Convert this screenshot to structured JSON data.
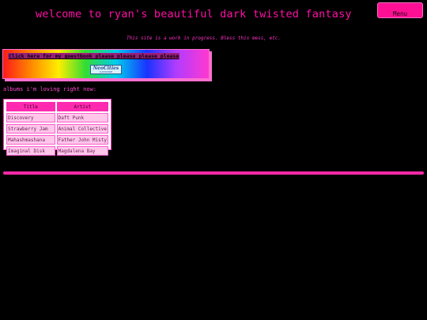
{
  "header": {
    "title": "welcome to ryan's beautiful dark twisted fantasy",
    "menu_label": "Menu",
    "subtitle": "This site is a work in progress. Bless this mess, etc."
  },
  "banner": {
    "guestbook_link": "Click here for my guestbook please please please please",
    "badge_main": "NeoCities",
    "badge_sub": "CUSTOMIZE"
  },
  "albums": {
    "heading": "albums i'm loving right now:",
    "columns": [
      "Title",
      "Artist"
    ],
    "rows": [
      [
        "Discovery",
        "Daft Punk"
      ],
      [
        "Strawberry Jam",
        "Animal Collective"
      ],
      [
        "Mahashmashana",
        "Father John Misty"
      ],
      [
        "Imaginal Disk",
        "Magdalena Bay"
      ]
    ]
  },
  "colors": {
    "background": "#000000",
    "accent_pink": "#ff0fa6",
    "table_header": "#ff2ab0",
    "table_cell": "#ffc6ea"
  }
}
